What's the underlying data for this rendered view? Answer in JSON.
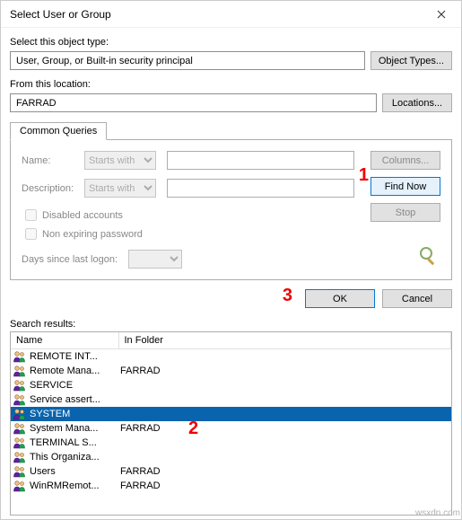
{
  "window": {
    "title": "Select User or Group"
  },
  "objectType": {
    "label": "Select this object type:",
    "value": "User, Group, or Built-in security principal",
    "button": "Object Types..."
  },
  "location": {
    "label": "From this location:",
    "value": "FARRAD",
    "button": "Locations..."
  },
  "tabs": {
    "common": "Common Queries"
  },
  "queries": {
    "nameLabel": "Name:",
    "nameMode": "Starts with",
    "descLabel": "Description:",
    "descMode": "Starts with",
    "disabled": "Disabled accounts",
    "nonExpiring": "Non expiring password",
    "daysLabel": "Days since last logon:"
  },
  "buttons": {
    "columns": "Columns...",
    "findNow": "Find Now",
    "stop": "Stop",
    "ok": "OK",
    "cancel": "Cancel"
  },
  "annotations": {
    "a1": "1",
    "a2": "2",
    "a3": "3"
  },
  "results": {
    "label": "Search results:",
    "cols": {
      "name": "Name",
      "folder": "In Folder"
    },
    "rows": [
      {
        "name": "REMOTE INT...",
        "folder": ""
      },
      {
        "name": "Remote Mana...",
        "folder": "FARRAD"
      },
      {
        "name": "SERVICE",
        "folder": ""
      },
      {
        "name": "Service assert...",
        "folder": ""
      },
      {
        "name": "SYSTEM",
        "folder": "",
        "selected": true
      },
      {
        "name": "System Mana...",
        "folder": "FARRAD"
      },
      {
        "name": "TERMINAL S...",
        "folder": ""
      },
      {
        "name": "This Organiza...",
        "folder": ""
      },
      {
        "name": "Users",
        "folder": "FARRAD"
      },
      {
        "name": "WinRMRemot...",
        "folder": "FARRAD"
      }
    ]
  },
  "watermark": "wsxdn.com"
}
